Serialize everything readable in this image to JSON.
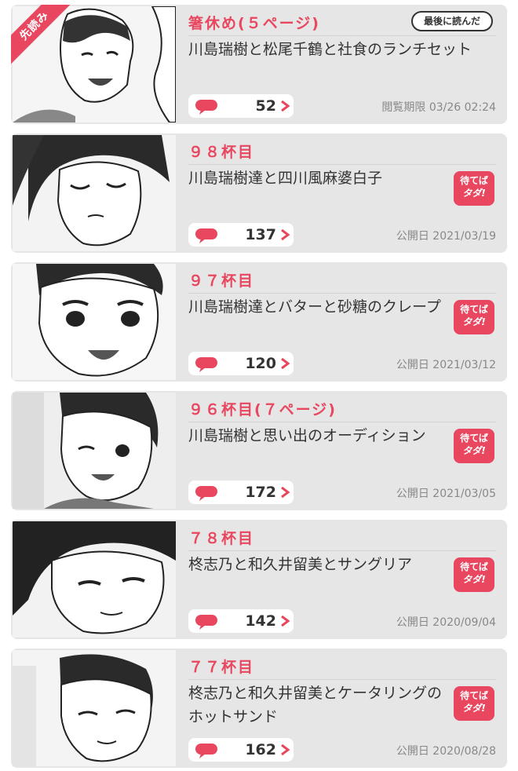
{
  "colors": {
    "accent": "#e8475f",
    "card_bg": "#e6e6e6",
    "text": "#333333",
    "meta": "#888888"
  },
  "episodes": [
    {
      "ribbon": "先読み",
      "title": "箸休め(５ページ)",
      "subtitle": "川島瑞樹と松尾千鶴と社食のランチセット",
      "badge": "最後に読んだ",
      "comments": "52",
      "date": "閲覧期限 03/26 02:24"
    },
    {
      "title": "９８杯目",
      "subtitle": "川島瑞樹達と四川風麻婆白子",
      "matte_line1": "待てば",
      "matte_line2": "タダ!",
      "comments": "137",
      "date": "公開日 2021/03/19"
    },
    {
      "title": "９７杯目",
      "subtitle": "川島瑞樹達とバターと砂糖のクレープ",
      "matte_line1": "待てば",
      "matte_line2": "タダ!",
      "comments": "120",
      "date": "公開日 2021/03/12"
    },
    {
      "title": "９６杯目(７ページ)",
      "subtitle": "川島瑞樹と思い出のオーディション",
      "matte_line1": "待てば",
      "matte_line2": "タダ!",
      "comments": "172",
      "date": "公開日 2021/03/05"
    },
    {
      "title": "７８杯目",
      "subtitle": "柊志乃と和久井留美とサングリア",
      "matte_line1": "待てば",
      "matte_line2": "タダ!",
      "comments": "142",
      "date": "公開日 2020/09/04"
    },
    {
      "title": "７７杯目",
      "subtitle": "柊志乃と和久井留美とケータリングのホットサンド",
      "matte_line1": "待てば",
      "matte_line2": "タダ!",
      "comments": "162",
      "date": "公開日 2020/08/28"
    }
  ]
}
